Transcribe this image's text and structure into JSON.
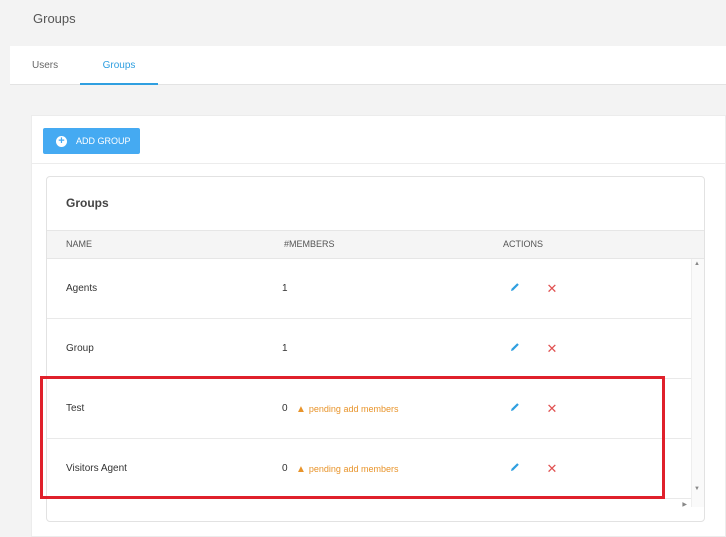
{
  "page": {
    "title": "Groups"
  },
  "tabs": [
    {
      "label": "Users",
      "active": false
    },
    {
      "label": "Groups",
      "active": true
    }
  ],
  "toolbar": {
    "add_group_label": "ADD GROUP",
    "add_icon": "plus-circle-icon"
  },
  "card": {
    "title": "Groups"
  },
  "table": {
    "columns": [
      "NAME",
      "#MEMBERS",
      "ACTIONS"
    ],
    "rows": [
      {
        "name": "Agents",
        "members": "1",
        "pending": ""
      },
      {
        "name": "Group",
        "members": "1",
        "pending": ""
      },
      {
        "name": "Test",
        "members": "0",
        "pending": "pending add members"
      },
      {
        "name": "Visitors Agent",
        "members": "0",
        "pending": "pending add members"
      }
    ]
  },
  "colors": {
    "accent": "#2f9fe0",
    "button": "#45aaf2",
    "warning": "#e8942b",
    "delete": "#e05252",
    "highlight": "#e0202b"
  }
}
